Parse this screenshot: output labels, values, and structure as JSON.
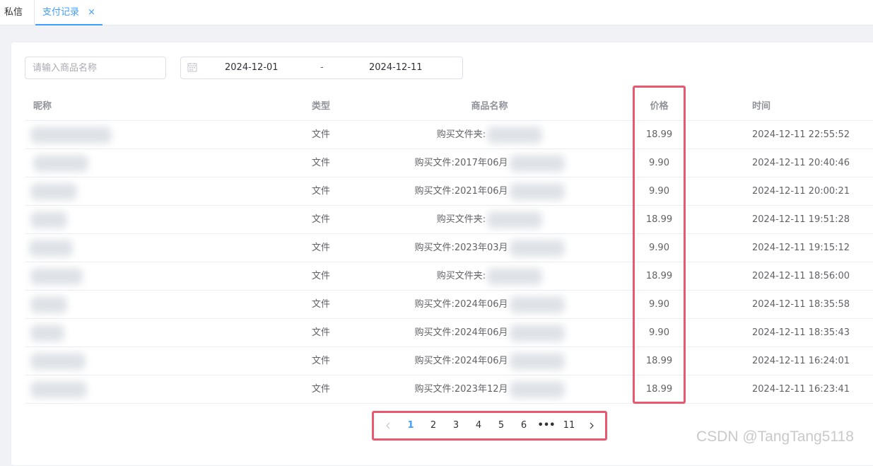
{
  "tabs": [
    {
      "label": "私信"
    },
    {
      "label": "支付记录",
      "close": "×"
    }
  ],
  "filters": {
    "goods_placeholder": "请输入商品名称",
    "date_start": "2024-12-01",
    "date_separator": "-",
    "date_end": "2024-12-11"
  },
  "table": {
    "columns": [
      "昵称",
      "类型",
      "商品名称",
      "价格",
      "时间"
    ],
    "rows": [
      {
        "type": "文件",
        "goods": "购买文件夹:",
        "price": "18.99",
        "time": "2024-12-11 22:55:52"
      },
      {
        "type": "文件",
        "goods": "购买文件:2017年06月",
        "price": "9.90",
        "time": "2024-12-11 20:40:46"
      },
      {
        "type": "文件",
        "goods": "购买文件:2021年06月",
        "price": "9.90",
        "time": "2024-12-11 20:00:21"
      },
      {
        "type": "文件",
        "goods": "购买文件夹:",
        "price": "18.99",
        "time": "2024-12-11 19:51:28"
      },
      {
        "type": "文件",
        "goods": "购买文件:2023年03月",
        "price": "9.90",
        "time": "2024-12-11 19:15:12"
      },
      {
        "type": "文件",
        "goods": "购买文件夹:",
        "price": "18.99",
        "time": "2024-12-11 18:56:00"
      },
      {
        "type": "文件",
        "goods": "购买文件:2024年06月",
        "price": "9.90",
        "time": "2024-12-11 18:35:58"
      },
      {
        "type": "文件",
        "goods": "购买文件:2024年06月",
        "price": "9.90",
        "time": "2024-12-11 18:35:43"
      },
      {
        "type": "文件",
        "goods": "购买文件:2024年06月",
        "price": "18.99",
        "time": "2024-12-11 16:24:01"
      },
      {
        "type": "文件",
        "goods": "购买文件:2023年12月",
        "price": "18.99",
        "time": "2024-12-11 16:23:41"
      }
    ]
  },
  "pagination": {
    "pages": [
      "1",
      "2",
      "3",
      "4",
      "5",
      "6",
      "•••",
      "11"
    ],
    "current": "1"
  },
  "watermark": "CSDN @TangTang5118",
  "colors": {
    "accent": "#409eff",
    "highlight": "#e8596f"
  }
}
